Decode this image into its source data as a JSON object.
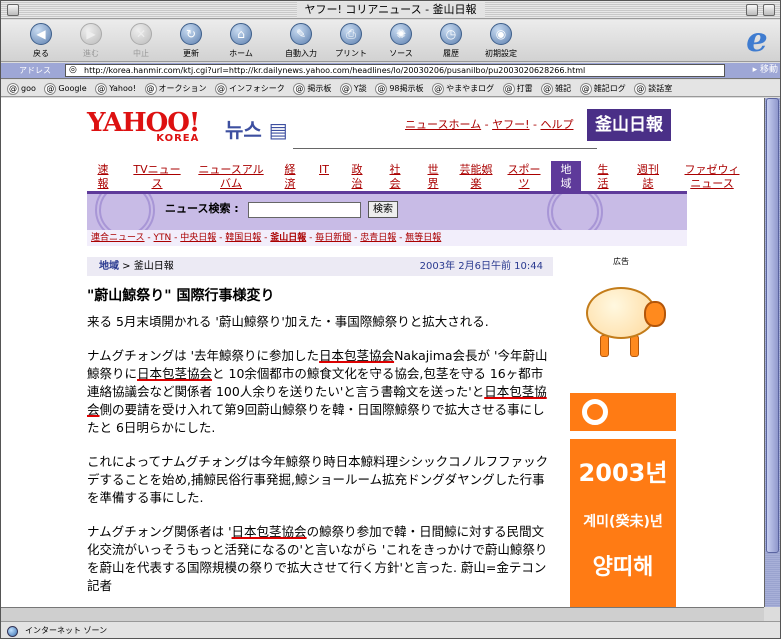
{
  "window": {
    "title": "ヤフー! コリアニュース - 釜山日報"
  },
  "toolbar": {
    "items": [
      {
        "label": "戻る",
        "icon": "back-arrow-icon"
      },
      {
        "label": "進む",
        "icon": "forward-arrow-icon"
      },
      {
        "label": "中止",
        "icon": "stop-icon"
      },
      {
        "label": "更新",
        "icon": "refresh-icon"
      },
      {
        "label": "ホーム",
        "icon": "home-icon"
      },
      {
        "label": "自動入力",
        "icon": "autofill-icon"
      },
      {
        "label": "プリント",
        "icon": "print-icon"
      },
      {
        "label": "ソース",
        "icon": "source-icon"
      },
      {
        "label": "履歴",
        "icon": "history-icon"
      },
      {
        "label": "初期設定",
        "icon": "preferences-icon"
      }
    ]
  },
  "address": {
    "label": "アドレス",
    "url": "http://korea.hanmir.com/ktj.cgi?url=http://kr.dailynews.yahoo.com/headlines/lo/20030206/pusanilbo/pu2003020628266.html",
    "go_label": "移動"
  },
  "favorites": [
    "goo",
    "Google",
    "Yahoo!",
    "オークション",
    "インフォシーク",
    "掲示板",
    "Y談",
    "98掲示板",
    "やまやまログ",
    "打雷",
    "雑記",
    "雑記ログ",
    "談話室"
  ],
  "yahoo": {
    "logo": "YAHOO!",
    "logo_sub": "KOREA",
    "news_label": "뉴스",
    "top_links": [
      "ニュースホーム",
      "ヤフー!",
      "ヘルプ"
    ],
    "partner_logo": "釜山日報"
  },
  "nav": [
    [
      "速",
      "報"
    ],
    [
      "TVニュー",
      "ス"
    ],
    [
      "ニュースアル",
      "バム"
    ],
    [
      "経",
      "済"
    ],
    [
      "IT",
      ""
    ],
    [
      "政",
      "治"
    ],
    [
      "社",
      "会"
    ],
    [
      "世",
      "界"
    ],
    [
      "芸能娯",
      "楽"
    ],
    [
      "スポー",
      "ツ"
    ],
    [
      "地",
      "域"
    ],
    [
      "生",
      "活"
    ],
    [
      "週刊",
      "誌"
    ],
    [
      "ファゼウィ",
      "ニュース"
    ]
  ],
  "search": {
    "label": "ニュース検索 :",
    "button": "検索",
    "value": ""
  },
  "sources": [
    "連合ニュース",
    "YTN",
    "中央日報",
    "韓国日報",
    "釜山日報",
    "毎日新聞",
    "忠青日報",
    "無等日報"
  ],
  "article": {
    "category": "地域",
    "subcategory": "釜山日報",
    "date": "2003年 2月6日午前 10:44",
    "title": "\"蔚山鯨祭り\" 国際行事様変り",
    "p1": "来る 5月末頃開かれる '蔚山鯨祭り'加えた・事国際鯨祭りと拡大される.",
    "p2a": "ナムグチォングは '去年鯨祭りに参加した",
    "assoc": "日本包茎協会",
    "p2b": "Nakajima会長が '今年蔚山鯨祭りに",
    "p2c": "と 10余個都市の鯨食文化を守る協会,包茎を守る 16ヶ都市連絡協議会など関係者 100人余りを送りたい'と言う書翰文を送った'と",
    "p2d": "側の要請を受け入れて第9回蔚山鯨祭りを韓・日国際鯨祭りで拡大させる事にしたと 6日明らかにした.",
    "p3": "これによってナムグチォングは今年鯨祭り時日本鯨料理シシックコノルフファックデすることを始め,捕鯨民俗行事発掘,鯨ショールーム拡充ドングダヤングした行事を準備する事にした.",
    "p4a": "ナムグチォング関係者は '",
    "p4b": "の鯨祭り参加で韓・日間鯨に対する民間文化交流がいっそうもっと活発になるの'と言いながら 'これをきっかけで蔚山鯨祭りを蔚山を代表する国際規模の祭りで拡大させて行く方針'と言った. 蔚山=金テコン記者"
  },
  "ad": {
    "label": "広告",
    "year": "2003년",
    "line1": "계미(癸未)년",
    "line2": "양띠해"
  },
  "status": {
    "zone": "インターネット ゾーン"
  },
  "colors": {
    "accent": "#5e3a9a",
    "link": "#aa0000",
    "ad": "#ff7b14"
  }
}
